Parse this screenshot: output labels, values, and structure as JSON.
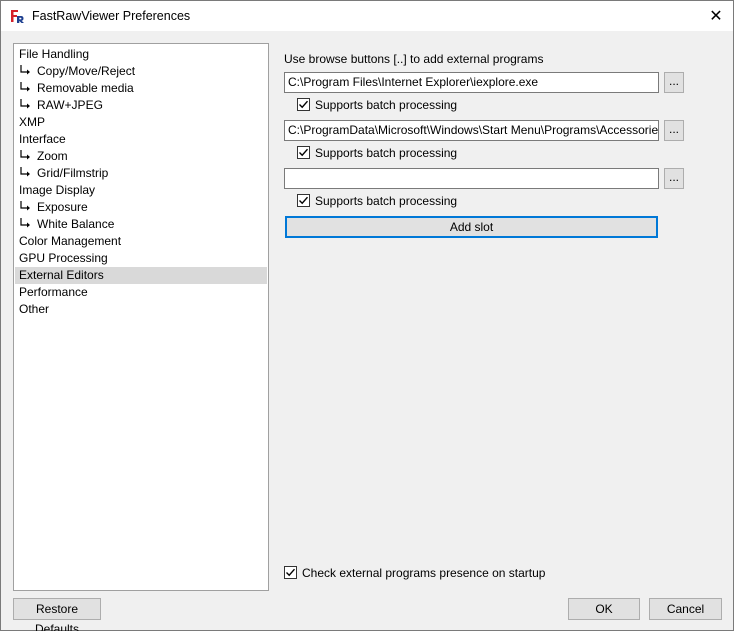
{
  "window": {
    "title": "FastRawViewer Preferences",
    "close_glyph": "✕",
    "icon": "fastrawviewer-app-icon"
  },
  "nav": {
    "items": [
      {
        "label": "File Handling",
        "child": false,
        "selected": false
      },
      {
        "label": "Copy/Move/Reject",
        "child": true,
        "selected": false
      },
      {
        "label": "Removable media",
        "child": true,
        "selected": false
      },
      {
        "label": "RAW+JPEG",
        "child": true,
        "selected": false
      },
      {
        "label": "XMP",
        "child": false,
        "selected": false
      },
      {
        "label": "Interface",
        "child": false,
        "selected": false
      },
      {
        "label": "Zoom",
        "child": true,
        "selected": false
      },
      {
        "label": "Grid/Filmstrip",
        "child": true,
        "selected": false
      },
      {
        "label": "Image Display",
        "child": false,
        "selected": false
      },
      {
        "label": "Exposure",
        "child": true,
        "selected": false
      },
      {
        "label": "White Balance",
        "child": true,
        "selected": false
      },
      {
        "label": "Color Management",
        "child": false,
        "selected": false
      },
      {
        "label": "GPU Processing",
        "child": false,
        "selected": false
      },
      {
        "label": "External Editors",
        "child": false,
        "selected": true
      },
      {
        "label": "Performance",
        "child": false,
        "selected": false
      },
      {
        "label": "Other",
        "child": false,
        "selected": false
      }
    ],
    "branch_glyph": "L▸"
  },
  "editors": {
    "hint": "Use browse buttons [..] to add external programs",
    "browse_label": "...",
    "batch_label": "Supports batch processing",
    "slots": [
      {
        "path": "C:\\Program Files\\Internet Explorer\\iexplore.exe",
        "batch": true
      },
      {
        "path": "C:\\ProgramData\\Microsoft\\Windows\\Start Menu\\Programs\\Accessories\\Paint",
        "batch": true
      },
      {
        "path": "",
        "batch": true
      }
    ],
    "add_slot_label": "Add slot",
    "check_startup_label": "Check external programs presence on startup",
    "check_startup": true
  },
  "footer": {
    "restore_label": "Restore Defaults",
    "ok_label": "OK",
    "cancel_label": "Cancel"
  },
  "colors": {
    "focus": "#0078d7",
    "selected_row": "#d9d9d9",
    "button_face": "#e1e1e1"
  }
}
